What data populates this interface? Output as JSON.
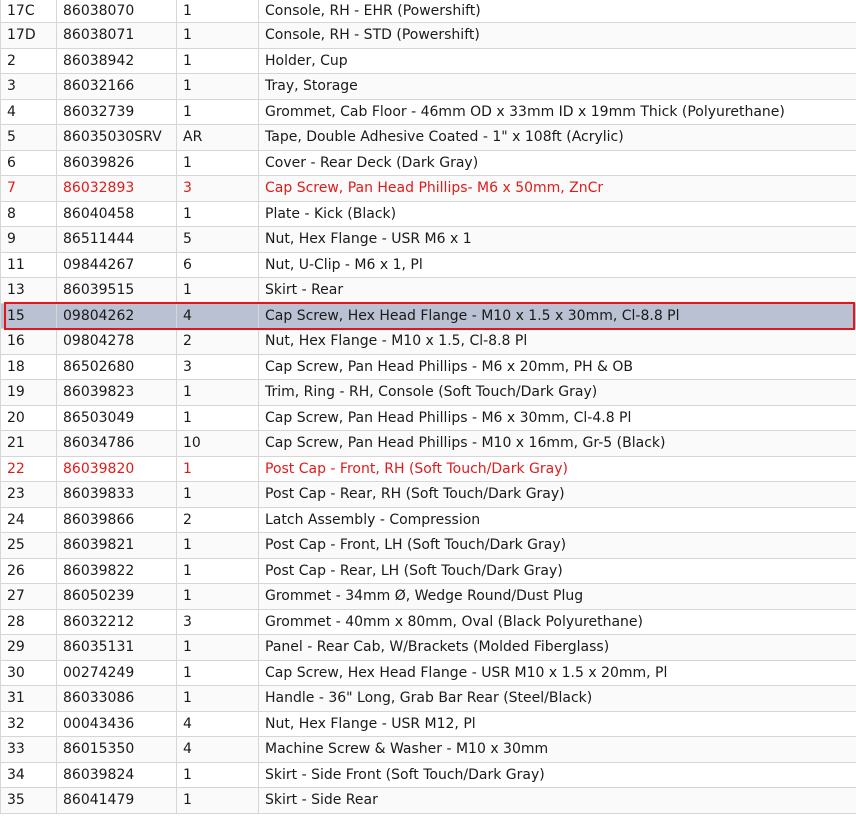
{
  "parts_list": {
    "selected_index": 12,
    "rows": [
      {
        "ref": "17C",
        "part": "86038070",
        "qty": "1",
        "desc": "Console, RH - EHR (Powershift)",
        "highlight": false
      },
      {
        "ref": "17D",
        "part": "86038071",
        "qty": "1",
        "desc": "Console, RH - STD (Powershift)",
        "highlight": false
      },
      {
        "ref": "2",
        "part": "86038942",
        "qty": "1",
        "desc": "Holder, Cup",
        "highlight": false
      },
      {
        "ref": "3",
        "part": "86032166",
        "qty": "1",
        "desc": "Tray, Storage",
        "highlight": false
      },
      {
        "ref": "4",
        "part": "86032739",
        "qty": "1",
        "desc": "Grommet, Cab Floor - 46mm OD x 33mm ID x 19mm Thick (Polyurethane)",
        "highlight": false
      },
      {
        "ref": "5",
        "part": "86035030SRV",
        "qty": "AR",
        "desc": "Tape, Double Adhesive Coated - 1\" x 108ft (Acrylic)",
        "highlight": false
      },
      {
        "ref": "6",
        "part": "86039826",
        "qty": "1",
        "desc": "Cover - Rear Deck (Dark Gray)",
        "highlight": false
      },
      {
        "ref": "7",
        "part": "86032893",
        "qty": "3",
        "desc": "Cap Screw, Pan Head Phillips- M6 x 50mm, ZnCr",
        "highlight": true
      },
      {
        "ref": "8",
        "part": "86040458",
        "qty": "1",
        "desc": "Plate - Kick (Black)",
        "highlight": false
      },
      {
        "ref": "9",
        "part": "86511444",
        "qty": "5",
        "desc": "Nut, Hex Flange - USR M6 x 1",
        "highlight": false
      },
      {
        "ref": "11",
        "part": "09844267",
        "qty": "6",
        "desc": "Nut, U-Clip - M6 x 1, Pl",
        "highlight": false
      },
      {
        "ref": "13",
        "part": "86039515",
        "qty": "1",
        "desc": "Skirt - Rear",
        "highlight": false
      },
      {
        "ref": "15",
        "part": "09804262",
        "qty": "4",
        "desc": "Cap Screw, Hex Head Flange - M10 x 1.5 x 30mm, Cl-8.8 Pl",
        "highlight": false
      },
      {
        "ref": "16",
        "part": "09804278",
        "qty": "2",
        "desc": "Nut, Hex Flange - M10 x 1.5, Cl-8.8 Pl",
        "highlight": false
      },
      {
        "ref": "18",
        "part": "86502680",
        "qty": "3",
        "desc": "Cap Screw, Pan Head Phillips - M6 x 20mm, PH & OB",
        "highlight": false
      },
      {
        "ref": "19",
        "part": "86039823",
        "qty": "1",
        "desc": "Trim, Ring - RH, Console (Soft Touch/Dark Gray)",
        "highlight": false
      },
      {
        "ref": "20",
        "part": "86503049",
        "qty": "1",
        "desc": "Cap Screw, Pan Head Phillips - M6 x 30mm, Cl-4.8 Pl",
        "highlight": false
      },
      {
        "ref": "21",
        "part": "86034786",
        "qty": "10",
        "desc": "Cap Screw, Pan Head Phillips - M10 x 16mm, Gr-5 (Black)",
        "highlight": false
      },
      {
        "ref": "22",
        "part": "86039820",
        "qty": "1",
        "desc": "Post Cap - Front, RH (Soft Touch/Dark Gray)",
        "highlight": true
      },
      {
        "ref": "23",
        "part": "86039833",
        "qty": "1",
        "desc": "Post Cap - Rear, RH (Soft Touch/Dark Gray)",
        "highlight": false
      },
      {
        "ref": "24",
        "part": "86039866",
        "qty": "2",
        "desc": "Latch Assembly - Compression",
        "highlight": false
      },
      {
        "ref": "25",
        "part": "86039821",
        "qty": "1",
        "desc": "Post Cap - Front, LH (Soft Touch/Dark Gray)",
        "highlight": false
      },
      {
        "ref": "26",
        "part": "86039822",
        "qty": "1",
        "desc": "Post Cap - Rear, LH (Soft Touch/Dark Gray)",
        "highlight": false
      },
      {
        "ref": "27",
        "part": "86050239",
        "qty": "1",
        "desc": "Grommet - 34mm Ø, Wedge Round/Dust Plug",
        "highlight": false
      },
      {
        "ref": "28",
        "part": "86032212",
        "qty": "3",
        "desc": "Grommet - 40mm x 80mm, Oval (Black Polyurethane)",
        "highlight": false
      },
      {
        "ref": "29",
        "part": "86035131",
        "qty": "1",
        "desc": "Panel - Rear Cab, W/Brackets (Molded Fiberglass)",
        "highlight": false
      },
      {
        "ref": "30",
        "part": "00274249",
        "qty": "1",
        "desc": "Cap Screw, Hex Head Flange - USR M10 x 1.5 x 20mm, Pl",
        "highlight": false
      },
      {
        "ref": "31",
        "part": "86033086",
        "qty": "1",
        "desc": "Handle - 36\" Long, Grab Bar Rear (Steel/Black)",
        "highlight": false
      },
      {
        "ref": "32",
        "part": "00043436",
        "qty": "4",
        "desc": "Nut, Hex Flange - USR M12, Pl",
        "highlight": false
      },
      {
        "ref": "33",
        "part": "86015350",
        "qty": "4",
        "desc": "Machine Screw & Washer - M10 x 30mm",
        "highlight": false
      },
      {
        "ref": "34",
        "part": "86039824",
        "qty": "1",
        "desc": "Skirt - Side Front (Soft Touch/Dark Gray)",
        "highlight": false
      },
      {
        "ref": "35",
        "part": "86041479",
        "qty": "1",
        "desc": "Skirt - Side Rear",
        "highlight": false
      }
    ]
  },
  "colors": {
    "highlight_text": "#e01b1b",
    "selected_row_bg": "#b9c1d3",
    "selection_frame": "#e3161c",
    "grid_line": "#d6d6d6"
  }
}
